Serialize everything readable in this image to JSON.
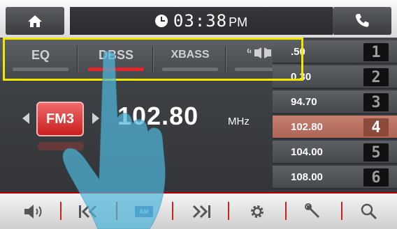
{
  "topbar": {
    "home_icon": "home-icon",
    "time": "03:38",
    "ampm": "PM",
    "phone_icon": "phone-icon"
  },
  "sound_buttons": [
    {
      "label": "EQ",
      "active": false
    },
    {
      "label": "DBSS",
      "active": true
    },
    {
      "label": "XBASS",
      "active": false
    },
    {
      "label": "speaker-balance-icon",
      "active": false
    }
  ],
  "tuner": {
    "band": "FM3",
    "frequency": "102.80",
    "unit": "MHz"
  },
  "presets": [
    {
      "freq": ".50",
      "num": "1",
      "active": false
    },
    {
      "freq": "0.30",
      "num": "2",
      "active": false
    },
    {
      "freq": "94.70",
      "num": "3",
      "active": false
    },
    {
      "freq": "102.80",
      "num": "4",
      "active": true
    },
    {
      "freq": "104.00",
      "num": "5",
      "active": false
    },
    {
      "freq": "108.00",
      "num": "6",
      "active": false
    }
  ],
  "bottombar": {
    "icons": [
      "volume-icon",
      "seek-back-icon",
      "am-band-icon",
      "seek-forward-icon",
      "settings-icon",
      "tools-icon",
      "search-icon"
    ],
    "am_label": "AM"
  },
  "colors": {
    "accent": "#e0262a",
    "highlight": "#f3e600",
    "active_preset": "#b06555"
  }
}
